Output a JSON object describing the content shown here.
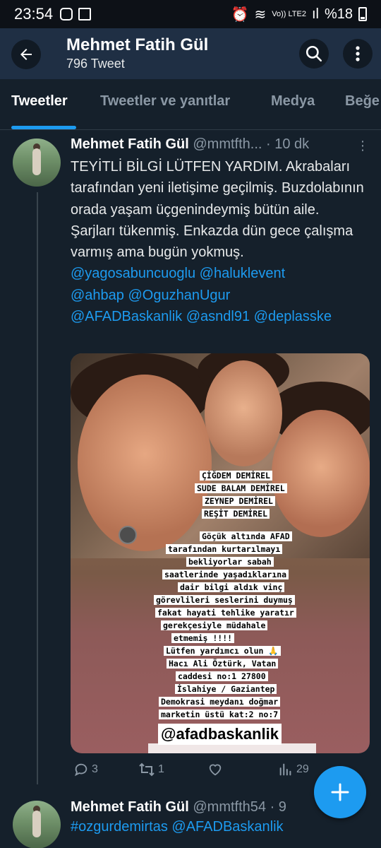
{
  "status_bar": {
    "time": "23:54",
    "network": "Vo)) LTE2",
    "battery": "%18"
  },
  "header": {
    "name": "Mehmet Fatih Gül",
    "tweet_count": "796 Tweet"
  },
  "tabs": [
    "Tweetler",
    "Tweetler ve yanıtlar",
    "Medya",
    "Beğe"
  ],
  "tweet": {
    "name": "Mehmet Fatih Gül",
    "handle": "@mmtfth...",
    "time": "· 10 dk",
    "text": "TEYİTLİ BİLGİ LÜTFEN YARDIM. Akrabaları tarafından yeni iletişime geçilmiş. Buzdolabının orada yaşam üçgenindeymiş bütün aile. Şarjları tükenmiş. Enkazda dün gece çalışma varmış ama bugün yokmuş.",
    "mentions": [
      "@yagosabuncuoglu",
      "@haluklevent",
      "@ahbap",
      "@OguzhanUgur",
      "@AFADBaskanlik",
      "@asndl91",
      "@deplasske"
    ],
    "image_text": {
      "names": [
        "ÇİĞDEM DEMİREL",
        "SUDE BALAM DEMİREL",
        "ZEYNEP DEMİREL",
        "REŞİT DEMİREL"
      ],
      "message": [
        "Göçük altında AFAD",
        "tarafından kurtarılmayı",
        "bekliyorlar sabah",
        "saatlerinde yaşadıklarına",
        "dair bilgi aldık vinç",
        "görevlileri seslerini duymuş",
        "fakat hayati tehlike yaratır",
        "gerekçesiyle müdahale",
        "etmemiş !!!!",
        "Lütfen yardımcı olun 🙏",
        "Hacı Ali Öztürk, Vatan",
        "caddesi no:1 27800",
        "İslahiye / Gaziantep",
        "Demokrasi meydanı doğmar",
        "marketin üstü kat:2 no:7"
      ],
      "tag": "@afadbaskanlik"
    },
    "stats": {
      "replies": "3",
      "retweets": "1",
      "likes": "",
      "views": "29"
    }
  },
  "tweet2": {
    "name": "Mehmet Fatih Gül",
    "handle": "@mmtfth54",
    "time": "· 9",
    "text": "#ozgurdemirtas @AFADBaskanlik"
  },
  "colors": {
    "accent": "#1d9bf0",
    "background": "#15202b",
    "header": "#1f2f44"
  }
}
